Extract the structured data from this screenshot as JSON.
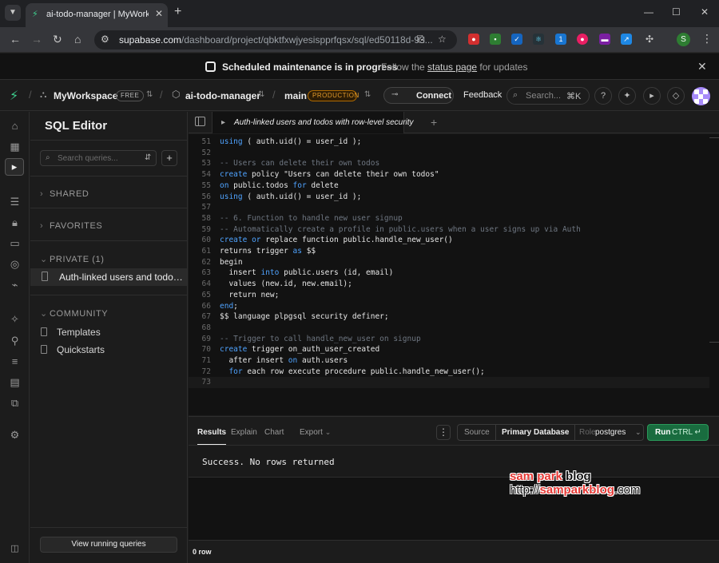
{
  "browser": {
    "tab_title": "ai-todo-manager | MyWorkspace",
    "url_main": "supabase.com",
    "url_path": "/dashboard/project/qbktfxwjyesispprfqsx/sql/ed50118d-93...",
    "profile_initial": "S"
  },
  "banner": {
    "title": "Scheduled maintenance is in progress",
    "subtitle_prefix": "Follow the ",
    "subtitle_link": "status page",
    "subtitle_suffix": " for updates"
  },
  "header": {
    "workspace": "MyWorkspace",
    "plan_badge": "FREE",
    "project": "ai-todo-manager",
    "branch": "main",
    "env_badge": "PRODUCTION",
    "connect_label": "Connect",
    "feedback_label": "Feedback",
    "search_placeholder": "Search...",
    "search_shortcut": "⌘K"
  },
  "sidebar": {
    "title": "SQL Editor",
    "search_placeholder": "Search queries...",
    "sections": {
      "shared": "SHARED",
      "favorites": "FAVORITES",
      "private": "PRIVATE (1)",
      "community": "COMMUNITY"
    },
    "private_item": "Auth-linked users and todos with row-level security",
    "community_items": [
      "Templates",
      "Quickstarts"
    ],
    "view_running": "View running queries"
  },
  "editor": {
    "tab_label": "Auth-linked users and todos with row-level security",
    "lines": [
      {
        "n": "51",
        "html": "<span class='k'>using</span> ( auth.uid() = user_id );"
      },
      {
        "n": "52",
        "html": ""
      },
      {
        "n": "53",
        "html": "<span class='c'>-- Users can delete their own todos</span>"
      },
      {
        "n": "54",
        "html": "<span class='k'>create</span> policy \"Users can delete their own todos\""
      },
      {
        "n": "55",
        "html": "<span class='k'>on</span> public.todos <span class='k'>for</span> delete"
      },
      {
        "n": "56",
        "html": "<span class='k'>using</span> ( auth.uid() = user_id );"
      },
      {
        "n": "57",
        "html": ""
      },
      {
        "n": "58",
        "html": "<span class='c'>-- 6. Function to handle new user signup</span>"
      },
      {
        "n": "59",
        "html": "<span class='c'>-- Automatically create a profile in public.users when a user signs up via Auth</span>"
      },
      {
        "n": "60",
        "html": "<span class='k'>create</span> <span class='k'>or</span> replace function public.handle_new_user()"
      },
      {
        "n": "61",
        "html": "returns trigger <span class='k'>as</span> $$"
      },
      {
        "n": "62",
        "html": "begin"
      },
      {
        "n": "63",
        "html": "  insert <span class='k'>into</span> public.users (id, email)"
      },
      {
        "n": "64",
        "html": "  values (new.id, new.email);"
      },
      {
        "n": "65",
        "html": "  return new;"
      },
      {
        "n": "66",
        "html": "<span class='k'>end</span>;"
      },
      {
        "n": "67",
        "html": "$$ language plpgsql security definer;"
      },
      {
        "n": "68",
        "html": ""
      },
      {
        "n": "69",
        "html": "<span class='c'>-- Trigger to call handle_new_user on signup</span>"
      },
      {
        "n": "70",
        "html": "<span class='k'>create</span> trigger on_auth_user_created"
      },
      {
        "n": "71",
        "html": "  after insert <span class='k'>on</span> auth.users"
      },
      {
        "n": "72",
        "html": "  <span class='k'>for</span> each row execute procedure public.handle_new_user();"
      },
      {
        "n": "73",
        "html": ""
      }
    ]
  },
  "results": {
    "tabs": [
      "Results",
      "Explain",
      "Chart",
      "Export"
    ],
    "source_label": "Source",
    "source_value": "Primary Database",
    "role_label": "Role",
    "role_value": "postgres",
    "run_label": "Run",
    "run_shortcut": "CTRL ↵",
    "message": "Success. No rows returned",
    "row_count": "0 row"
  },
  "watermark": {
    "line1_red": "sam park",
    "line1_dark": " blog",
    "line2_prefix": "http://",
    "line2_red": "samparkblog",
    "line2_suffix": ".com"
  },
  "colors": {
    "brand": "#3ecf8e",
    "run_button": "#196c3f",
    "keyword": "#4fa3ff",
    "production": "#e39b2b"
  }
}
